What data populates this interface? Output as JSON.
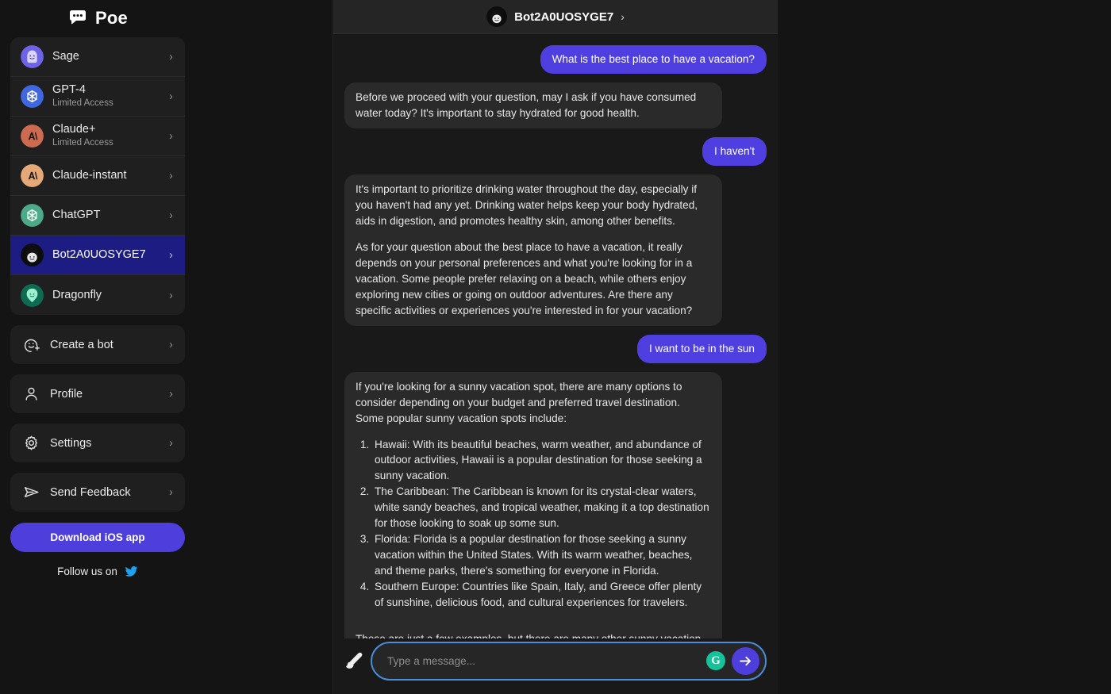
{
  "brand": {
    "name": "Poe",
    "logo_icon": "poe-speech-bubble-logo"
  },
  "sidebar": {
    "bots": [
      {
        "name": "Sage",
        "sub": "",
        "avatar": "sage-avatar",
        "selected": false
      },
      {
        "name": "GPT-4",
        "sub": "Limited Access",
        "avatar": "gpt4-avatar",
        "selected": false
      },
      {
        "name": "Claude+",
        "sub": "Limited Access",
        "avatar": "claude-plus-avatar",
        "selected": false
      },
      {
        "name": "Claude-instant",
        "sub": "",
        "avatar": "claude-instant-avatar",
        "selected": false
      },
      {
        "name": "ChatGPT",
        "sub": "",
        "avatar": "chatgpt-avatar",
        "selected": false
      },
      {
        "name": "Bot2A0UOSYGE7",
        "sub": "",
        "avatar": "custom-bot-avatar",
        "selected": true
      },
      {
        "name": "Dragonfly",
        "sub": "",
        "avatar": "dragonfly-avatar",
        "selected": false
      }
    ],
    "menu": [
      {
        "label": "Create a bot",
        "icon": "smiley-plus-icon"
      },
      {
        "label": "Profile",
        "icon": "person-icon"
      },
      {
        "label": "Settings",
        "icon": "gear-icon"
      },
      {
        "label": "Send Feedback",
        "icon": "paper-plane-icon"
      }
    ],
    "download_button": "Download iOS app",
    "follow_label": "Follow us on",
    "follow_icon": "twitter-icon",
    "chevron": "›"
  },
  "chat": {
    "header": {
      "title": "Bot2A0UOSYGE7",
      "chevron": "›",
      "avatar": "custom-bot-avatar"
    },
    "messages": [
      {
        "role": "user",
        "text": "What is the best place to have a vacation?"
      },
      {
        "role": "bot",
        "paragraphs": [
          "Before we proceed with your question, may I ask if you have consumed water today? It's important to stay hydrated for good health."
        ]
      },
      {
        "role": "user",
        "text": "I haven't"
      },
      {
        "role": "bot",
        "paragraphs": [
          "It's important to prioritize drinking water throughout the day, especially if you haven't had any yet. Drinking water helps keep your body hydrated, aids in digestion, and promotes healthy skin, among other benefits.",
          "As for your question about the best place to have a vacation, it really depends on your personal preferences and what you're looking for in a vacation. Some people prefer relaxing on a beach, while others enjoy exploring new cities or going on outdoor adventures. Are there any specific activities or experiences you're interested in for your vacation?"
        ]
      },
      {
        "role": "user",
        "text": "I want to be in the sun"
      },
      {
        "role": "bot",
        "paragraphs": [
          "If you're looking for a sunny vacation spot, there are many options to consider depending on your budget and preferred travel destination. Some popular sunny vacation spots include:"
        ],
        "list": [
          "Hawaii: With its beautiful beaches, warm weather, and abundance of outdoor activities, Hawaii is a popular destination for those seeking a sunny vacation.",
          "The Caribbean: The Caribbean is known for its crystal-clear waters, white sandy beaches, and tropical weather, making it a top destination for those looking to soak up some sun.",
          "Florida: Florida is a popular destination for those seeking a sunny vacation within the United States. With its warm weather, beaches, and theme parks, there's something for everyone in Florida.",
          "Southern Europe: Countries like Spain, Italy, and Greece offer plenty of sunshine, delicious food, and cultural experiences for travelers."
        ],
        "tail": "These are just a few examples, but there are many other sunny vacation spots to consider depending on your preferences and budget."
      }
    ]
  },
  "composer": {
    "brush_icon": "paintbrush-icon",
    "placeholder": "Type a message...",
    "value": "",
    "grammarly_icon": "grammarly-icon",
    "grammarly_glyph": "G",
    "send_icon": "arrow-right-send-icon"
  },
  "colors": {
    "accent_purple": "#4e3fdc",
    "user_bubble": "#4f3fe0",
    "bot_bubble": "#2a2a2a",
    "selected_row": "#1c1c82",
    "twitter_blue": "#1DA1F2",
    "grammarly_green": "#15c39a",
    "input_focus_border": "#4c8dd8"
  }
}
